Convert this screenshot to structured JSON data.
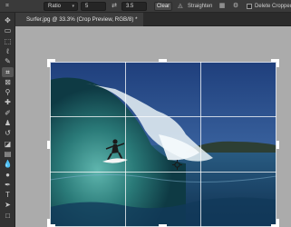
{
  "options": {
    "ratio_label": "Ratio",
    "width_value": "5",
    "swap_icon": "swap-arrows-icon",
    "height_value": "3.5",
    "clear_label": "Clear",
    "straighten_label": "Straighten",
    "grid_overlay_icon": "grid-overlay-icon",
    "settings_icon": "gear-icon",
    "delete_cropped_label": "Delete Cropped Pi"
  },
  "document": {
    "tab_title": "Surfer.jpg @ 33.3% (Crop Preview, RGB/8) *"
  },
  "tools": [
    {
      "name": "move-tool-icon",
      "glyph": "✥"
    },
    {
      "name": "artboard-tool-icon",
      "glyph": "▭"
    },
    {
      "name": "marquee-tool-icon",
      "glyph": "⬚"
    },
    {
      "name": "lasso-tool-icon",
      "glyph": "ℓ"
    },
    {
      "name": "quick-select-tool-icon",
      "glyph": "✎"
    },
    {
      "name": "crop-tool-icon",
      "glyph": "⌗"
    },
    {
      "name": "frame-tool-icon",
      "glyph": "⊠"
    },
    {
      "name": "eyedropper-tool-icon",
      "glyph": "⚲"
    },
    {
      "name": "healing-brush-tool-icon",
      "glyph": "✚"
    },
    {
      "name": "brush-tool-icon",
      "glyph": "✐"
    },
    {
      "name": "clone-stamp-tool-icon",
      "glyph": "♟"
    },
    {
      "name": "history-brush-tool-icon",
      "glyph": "↺"
    },
    {
      "name": "eraser-tool-icon",
      "glyph": "◪"
    },
    {
      "name": "gradient-tool-icon",
      "glyph": "▤"
    },
    {
      "name": "blur-tool-icon",
      "glyph": "💧"
    },
    {
      "name": "dodge-tool-icon",
      "glyph": "●"
    },
    {
      "name": "pen-tool-icon",
      "glyph": "✒"
    },
    {
      "name": "type-tool-icon",
      "glyph": "T"
    },
    {
      "name": "path-selection-tool-icon",
      "glyph": "➤"
    },
    {
      "name": "rectangle-tool-icon",
      "glyph": "□"
    }
  ],
  "active_tool": "crop-tool-icon"
}
